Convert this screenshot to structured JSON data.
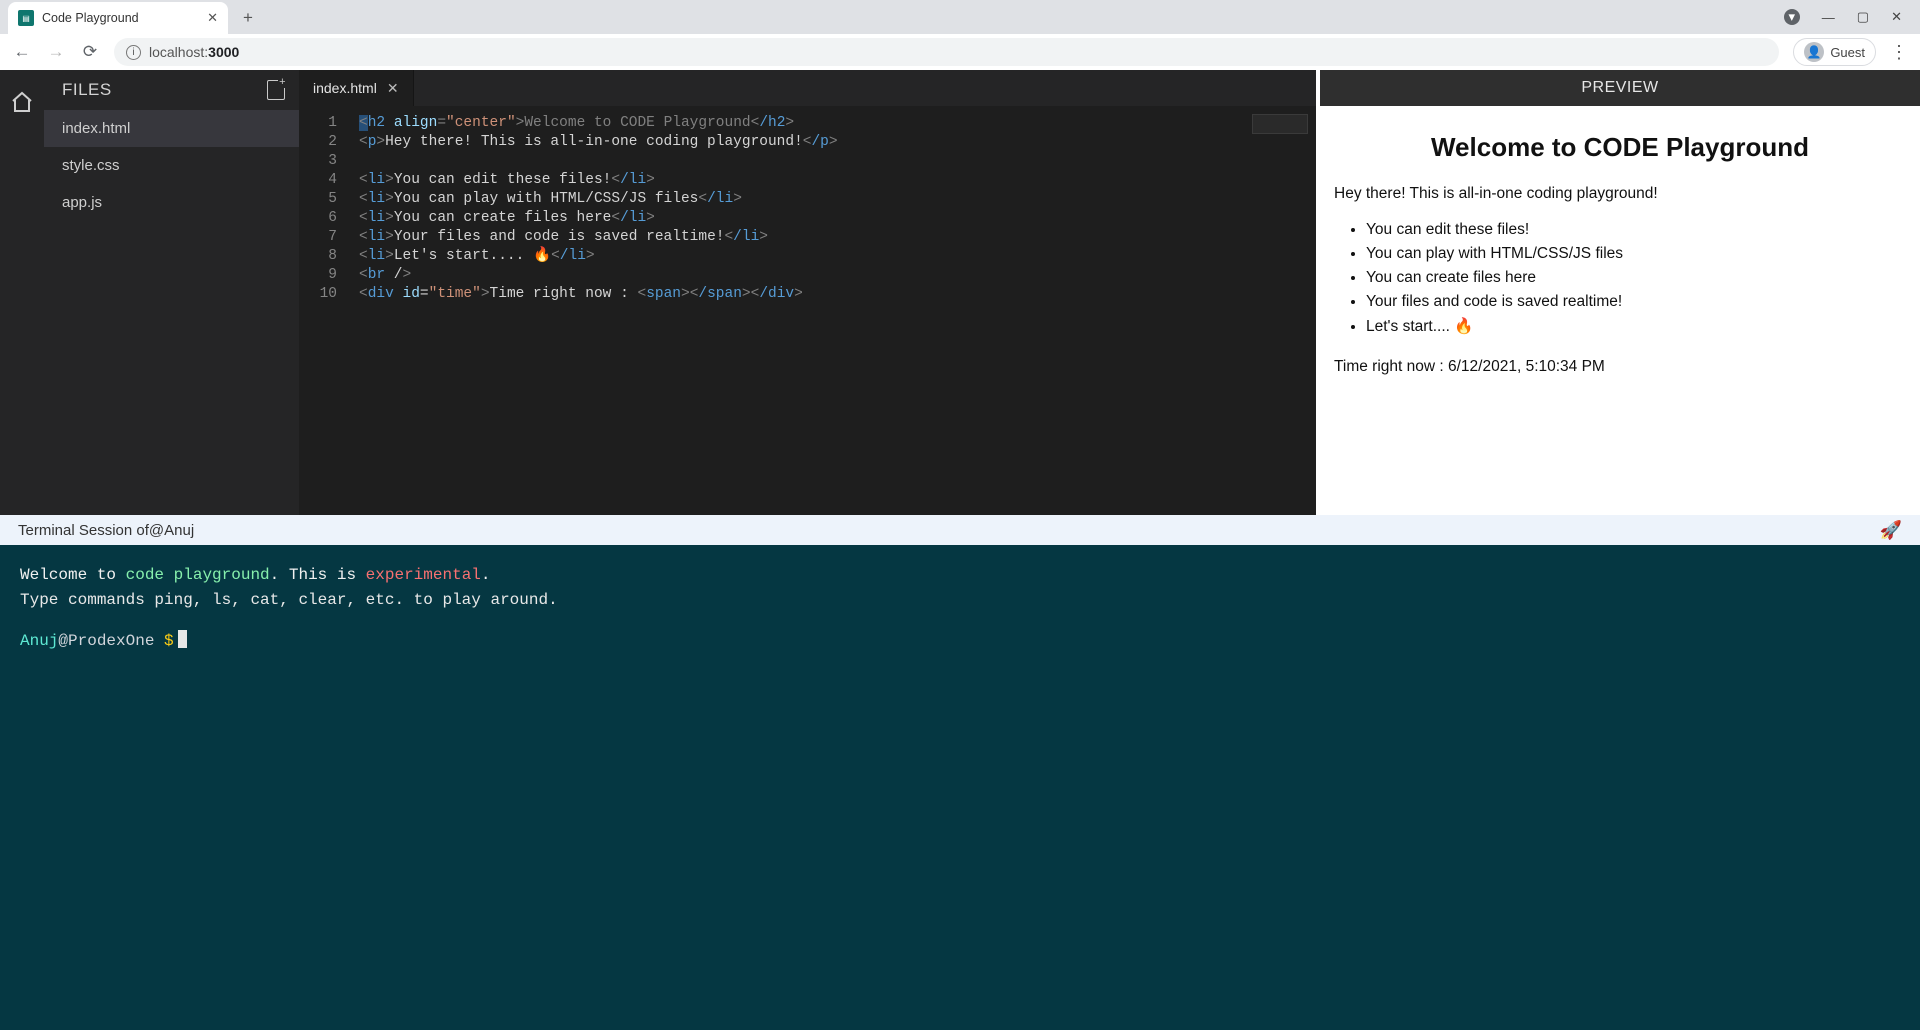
{
  "browser": {
    "tab_title": "Code Playground",
    "url_host": "localhost:",
    "url_port": "3000",
    "guest_label": "Guest"
  },
  "sidebar": {
    "header": "FILES",
    "files": [
      "index.html",
      "style.css",
      "app.js"
    ],
    "active_index": 0
  },
  "editor": {
    "tab_label": "index.html",
    "gutter": [
      "1",
      "2",
      "3",
      "4",
      "5",
      "6",
      "7",
      "8",
      "9",
      "10"
    ],
    "lines": [
      {
        "raw": "<h2 align=\"center\">Welcome to CODE Playground</h2>"
      },
      {
        "raw": "<p>Hey there! This is all-in-one coding playground!</p>"
      },
      {
        "raw": ""
      },
      {
        "raw": "<li>You can edit these files!</li>"
      },
      {
        "raw": "<li>You can play with HTML/CSS/JS files</li>"
      },
      {
        "raw": "<li>You can create files here</li>"
      },
      {
        "raw": "<li>Your files and code is saved realtime!</li>"
      },
      {
        "raw": "<li>Let's start.... 🔥</li>"
      },
      {
        "raw": "<br/>"
      },
      {
        "raw": "<div id=\"time\">Time right now : <span></span></div>"
      }
    ]
  },
  "preview": {
    "header": "PREVIEW",
    "h2": "Welcome to CODE Playground",
    "p": "Hey there! This is all-in-one coding playground!",
    "items": [
      "You can edit these files!",
      "You can play with HTML/CSS/JS files",
      "You can create files here",
      "Your files and code is saved realtime!",
      "Let's start.... 🔥"
    ],
    "time_label": "Time right now : ",
    "time_value": "6/12/2021, 5:10:34 PM"
  },
  "terminal": {
    "header_prefix": "Terminal Session of ",
    "header_user": "@Anuj",
    "line1_a": "Welcome to ",
    "line1_b": "code playground",
    "line1_c": ". This is ",
    "line1_d": "experimental",
    "line1_e": ".",
    "line2": "Type commands ping, ls, cat, clear, etc. to play around.",
    "prompt_user": "Anuj",
    "prompt_at": "@",
    "prompt_host": "ProdexOne ",
    "prompt_sym": "$"
  }
}
